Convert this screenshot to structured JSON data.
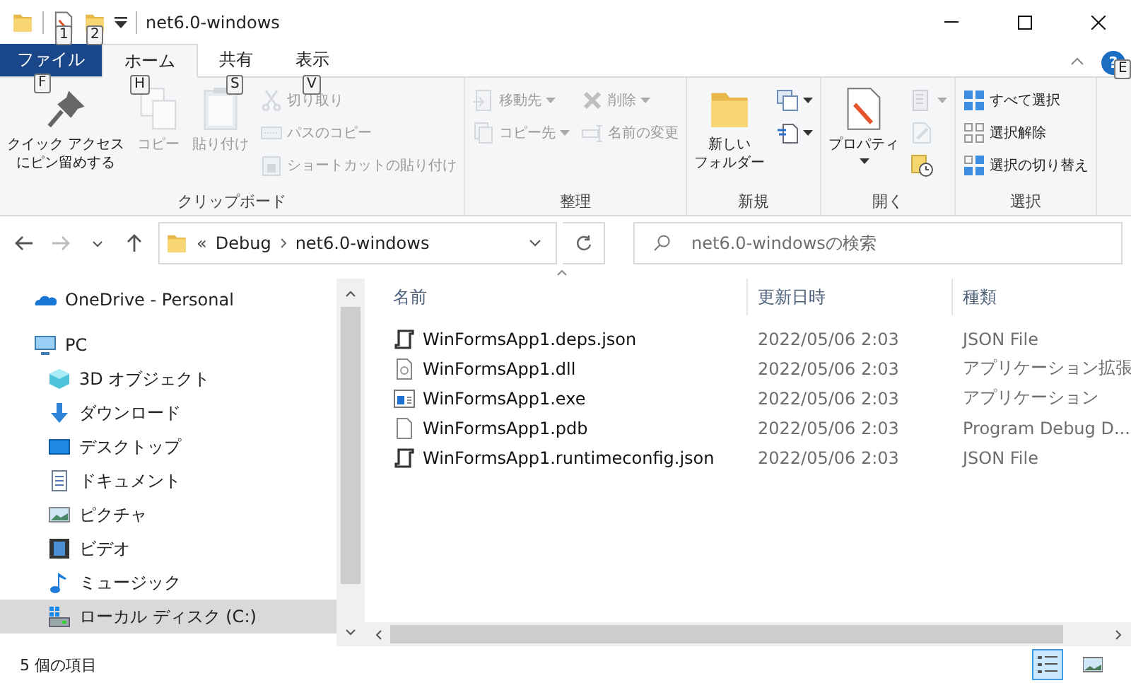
{
  "window": {
    "title": "net6.0-windows"
  },
  "quick_access": [
    {
      "keytip": "1"
    },
    {
      "keytip": "2"
    }
  ],
  "tabs": [
    {
      "label": "ファイル",
      "keytip": "F",
      "kind": "file",
      "selected": false
    },
    {
      "label": "ホーム",
      "keytip": "H",
      "kind": "tab",
      "selected": true
    },
    {
      "label": "共有",
      "keytip": "S",
      "kind": "tab",
      "selected": false
    },
    {
      "label": "表示",
      "keytip": "V",
      "kind": "tab",
      "selected": false
    }
  ],
  "help": {
    "glyph": "?",
    "keytip": "E"
  },
  "ribbon": [
    {
      "label": "クリップボード",
      "columns": [
        {
          "kind": "large",
          "lines": [
            "クイック アクセス",
            "にピン留めする"
          ],
          "disabled": false
        },
        {
          "kind": "large",
          "lines": [
            "コピー"
          ],
          "disabled": true
        },
        {
          "kind": "large",
          "lines": [
            "貼り付け"
          ],
          "disabled": true
        },
        {
          "kind": "stack",
          "items": [
            {
              "label": "切り取り",
              "disabled": true
            },
            {
              "label": "パスのコピー",
              "disabled": true
            },
            {
              "label": "ショートカットの貼り付け",
              "disabled": true
            }
          ]
        }
      ]
    },
    {
      "label": "整理",
      "columns": [
        {
          "kind": "stack",
          "items": [
            {
              "label": "移動先",
              "disabled": true,
              "dropdown": true
            },
            {
              "label": "コピー先",
              "disabled": true,
              "dropdown": true
            }
          ]
        },
        {
          "kind": "stack",
          "items": [
            {
              "label": "削除",
              "disabled": true,
              "dropdown": true
            },
            {
              "label": "名前の変更",
              "disabled": true
            }
          ]
        }
      ]
    },
    {
      "label": "新規",
      "columns": [
        {
          "kind": "large",
          "lines": [
            "新しい",
            "フォルダー"
          ],
          "disabled": false
        },
        {
          "kind": "stack",
          "items": [
            {
              "disabled": false,
              "dropdown": true
            },
            {
              "disabled": false,
              "dropdown": true
            }
          ]
        }
      ]
    },
    {
      "label": "開く",
      "columns": [
        {
          "kind": "large",
          "lines": [
            "プロパティ"
          ],
          "disabled": false,
          "dropdown": true
        },
        {
          "kind": "stack",
          "items": [
            {
              "disabled": true,
              "dropdown": true
            },
            {
              "disabled": true
            },
            {
              "disabled": false
            }
          ]
        }
      ]
    },
    {
      "label": "選択",
      "columns": [
        {
          "kind": "stack",
          "items": [
            {
              "label": "すべて選択",
              "disabled": false
            },
            {
              "label": "選択解除",
              "disabled": false
            },
            {
              "label": "選択の切り替え",
              "disabled": false
            }
          ]
        }
      ]
    }
  ],
  "nav": [
    {
      "kind": "back",
      "disabled": false
    },
    {
      "kind": "forward",
      "disabled": true
    },
    {
      "kind": "recent",
      "disabled": false
    },
    {
      "kind": "up",
      "disabled": false
    }
  ],
  "address": {
    "overflow": "«",
    "crumbs": [
      "Debug",
      "net6.0-windows"
    ]
  },
  "search": {
    "placeholder": "net6.0-windowsの検索"
  },
  "sidebar": [
    {
      "label": "OneDrive - Personal",
      "selected": false
    },
    {
      "label": "PC",
      "selected": false,
      "children": [
        {
          "label": "3D オブジェクト",
          "selected": false
        },
        {
          "label": "ダウンロード",
          "selected": false
        },
        {
          "label": "デスクトップ",
          "selected": false
        },
        {
          "label": "ドキュメント",
          "selected": false
        },
        {
          "label": "ピクチャ",
          "selected": false
        },
        {
          "label": "ビデオ",
          "selected": false
        },
        {
          "label": "ミュージック",
          "selected": false
        },
        {
          "label": "ローカル ディスク (C:)",
          "selected": true
        }
      ]
    }
  ],
  "table": {
    "columns": [
      "名前",
      "更新日時",
      "種類"
    ],
    "rows": [
      {
        "name": "WinFormsApp1.deps.json",
        "modified": "2022/05/06 2:03",
        "type": "JSON File"
      },
      {
        "name": "WinFormsApp1.dll",
        "modified": "2022/05/06 2:03",
        "type": "アプリケーション拡張"
      },
      {
        "name": "WinFormsApp1.exe",
        "modified": "2022/05/06 2:03",
        "type": "アプリケーション"
      },
      {
        "name": "WinFormsApp1.pdb",
        "modified": "2022/05/06 2:03",
        "type": "Program Debug D..."
      },
      {
        "name": "WinFormsApp1.runtimeconfig.json",
        "modified": "2022/05/06 2:03",
        "type": "JSON File"
      }
    ]
  },
  "status_bar": {
    "count": "5 個の項目"
  },
  "views": [
    {
      "kind": "details",
      "selected": true
    },
    {
      "kind": "large",
      "selected": false
    }
  ]
}
